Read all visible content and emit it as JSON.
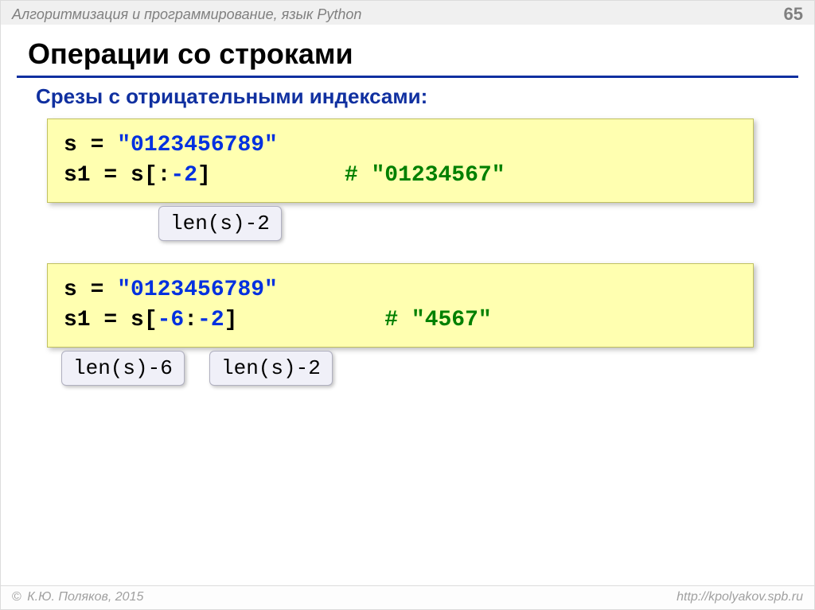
{
  "header": {
    "subject": "Алгоритмизация и программирование, язык Python",
    "page": "65"
  },
  "title": "Операции со строками",
  "subtitle": "Срезы с отрицательными индексами:",
  "block1": {
    "line1_a": "s = ",
    "line1_b": "\"0123456789\"",
    "line2_a": "s1 = s[:",
    "line2_b": "-2",
    "line2_c": "]          ",
    "line2_d": "# \"01234567\""
  },
  "note1": "len(s)-2",
  "block2": {
    "line1_a": "s = ",
    "line1_b": "\"0123456789\"",
    "line2_a": "s1 = s[",
    "line2_b": "-6",
    "line2_c": ":",
    "line2_d": "-2",
    "line2_e": "]           ",
    "line2_f": "# \"4567\""
  },
  "note2": "len(s)-6",
  "note3": "len(s)-2",
  "footer": {
    "author": "К.Ю. Поляков, 2015",
    "url": "http://kpolyakov.spb.ru"
  }
}
